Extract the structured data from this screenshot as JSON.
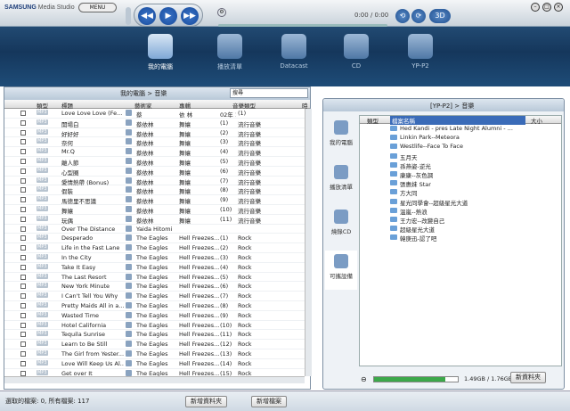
{
  "app": {
    "logo": "SAMSUNG",
    "logo_sub": "Media Studio",
    "menu": "MENU",
    "time": "0:00 / 0:00"
  },
  "nav": [
    {
      "label": "我的電腦"
    },
    {
      "label": "播放清單"
    },
    {
      "label": "Datacast"
    },
    {
      "label": "CD"
    },
    {
      "label": "YP-P2"
    }
  ],
  "left": {
    "breadcrumb": "我的電腦 > 音樂",
    "search_placeholder": "搜尋",
    "columns": [
      "類型",
      "標題",
      "藝術家",
      "專輯",
      "音樂類型",
      "時"
    ],
    "rows": [
      [
        "Love Love Love (Fe...",
        "蔡",
        "依  林",
        "02年  1  ...",
        "(1)",
        ""
      ],
      [
        "開場白",
        "蔡依林",
        "舞孃",
        "(1)",
        "流行音樂",
        ""
      ],
      [
        "好好好",
        "蔡依林",
        "舞孃",
        "(2)",
        "流行音樂",
        ""
      ],
      [
        "奈何",
        "蔡依林",
        "舞孃",
        "(3)",
        "流行音樂",
        ""
      ],
      [
        "Mr.Q",
        "蔡依林",
        "舞孃",
        "(4)",
        "流行音樂",
        ""
      ],
      [
        "離人節",
        "蔡依林",
        "舞孃",
        "(5)",
        "流行音樂",
        ""
      ],
      [
        "心型圈",
        "蔡依林",
        "舞孃",
        "(6)",
        "流行音樂",
        ""
      ],
      [
        "愛情熱帶 (Bonus)",
        "蔡依林",
        "舞孃",
        "(7)",
        "流行音樂",
        ""
      ],
      [
        "假裝",
        "蔡依林",
        "舞孃",
        "(8)",
        "流行音樂",
        ""
      ],
      [
        "馬德里不思議",
        "蔡依林",
        "舞孃",
        "(9)",
        "流行音樂",
        ""
      ],
      [
        "舞孃",
        "蔡依林",
        "舞孃",
        "(10)",
        "流行音樂",
        ""
      ],
      [
        "玩偶",
        "蔡依林",
        "舞孃",
        "(11)",
        "流行音樂",
        ""
      ],
      [
        "Over The Distance",
        "Yaida Hitomi",
        "",
        "",
        "",
        ""
      ],
      [
        "Desperado",
        "The Eagles",
        "Hell Freezes...",
        "(1)",
        "Rock",
        ""
      ],
      [
        "Life in the Fast Lane",
        "The Eagles",
        "Hell Freezes...",
        "(2)",
        "Rock",
        ""
      ],
      [
        "In the City",
        "The Eagles",
        "Hell Freezes...",
        "(3)",
        "Rock",
        ""
      ],
      [
        "Take It Easy",
        "The Eagles",
        "Hell Freezes...",
        "(4)",
        "Rock",
        ""
      ],
      [
        "The Last Resort",
        "The Eagles",
        "Hell Freezes...",
        "(5)",
        "Rock",
        ""
      ],
      [
        "New York Minute",
        "The Eagles",
        "Hell Freezes...",
        "(6)",
        "Rock",
        ""
      ],
      [
        "I Can't Tell You Why",
        "The Eagles",
        "Hell Freezes...",
        "(7)",
        "Rock",
        ""
      ],
      [
        "Pretty Maids All in a...",
        "The Eagles",
        "Hell Freezes...",
        "(8)",
        "Rock",
        ""
      ],
      [
        "Wasted Time",
        "The Eagles",
        "Hell Freezes...",
        "(9)",
        "Rock",
        ""
      ],
      [
        "Hotel California",
        "The Eagles",
        "Hell Freezes...",
        "(10)",
        "Rock",
        ""
      ],
      [
        "Tequila Sunrise",
        "The Eagles",
        "Hell Freezes...",
        "(11)",
        "Rock",
        ""
      ],
      [
        "Learn to Be Still",
        "The Eagles",
        "Hell Freezes...",
        "(12)",
        "Rock",
        ""
      ],
      [
        "The Girl from Yester...",
        "The Eagles",
        "Hell Freezes...",
        "(13)",
        "Rock",
        ""
      ],
      [
        "Love Will Keep Us Al...",
        "The Eagles",
        "Hell Freezes...",
        "(14)",
        "Rock",
        ""
      ],
      [
        "Get over It",
        "The Eagles",
        "Hell Freezes...",
        "(15)",
        "Rock",
        ""
      ]
    ]
  },
  "right": {
    "breadcrumb": "[YP-P2] > 音樂",
    "tabs": [
      "我的電腦",
      "播放清單",
      "燒錄CD",
      "可攜設備"
    ],
    "columns": [
      "類型",
      "檔案名稱",
      "大小"
    ],
    "items": [
      "Hed Kandi - pres Late Night Alumni - ...",
      "Linkin Park--Meteora",
      "Westlife--Face To Face",
      "五月天",
      "孫燕姿-逆光",
      "康康--灰色調",
      "張惠妹 Star",
      "方大同",
      "星光同學會--超級星光大道",
      "溫嵐--熱浪",
      "王力宏--改變自己",
      "超級星光大道",
      "韓庚迅-認了吧"
    ],
    "storage": "1.49GB / 1.76GB",
    "new_folder": "新資料夾"
  },
  "status": {
    "text": "選取的檔案: 0, 所有檔案: 117",
    "new_folder": "新增資料夾",
    "new_file": "新增檔案"
  }
}
